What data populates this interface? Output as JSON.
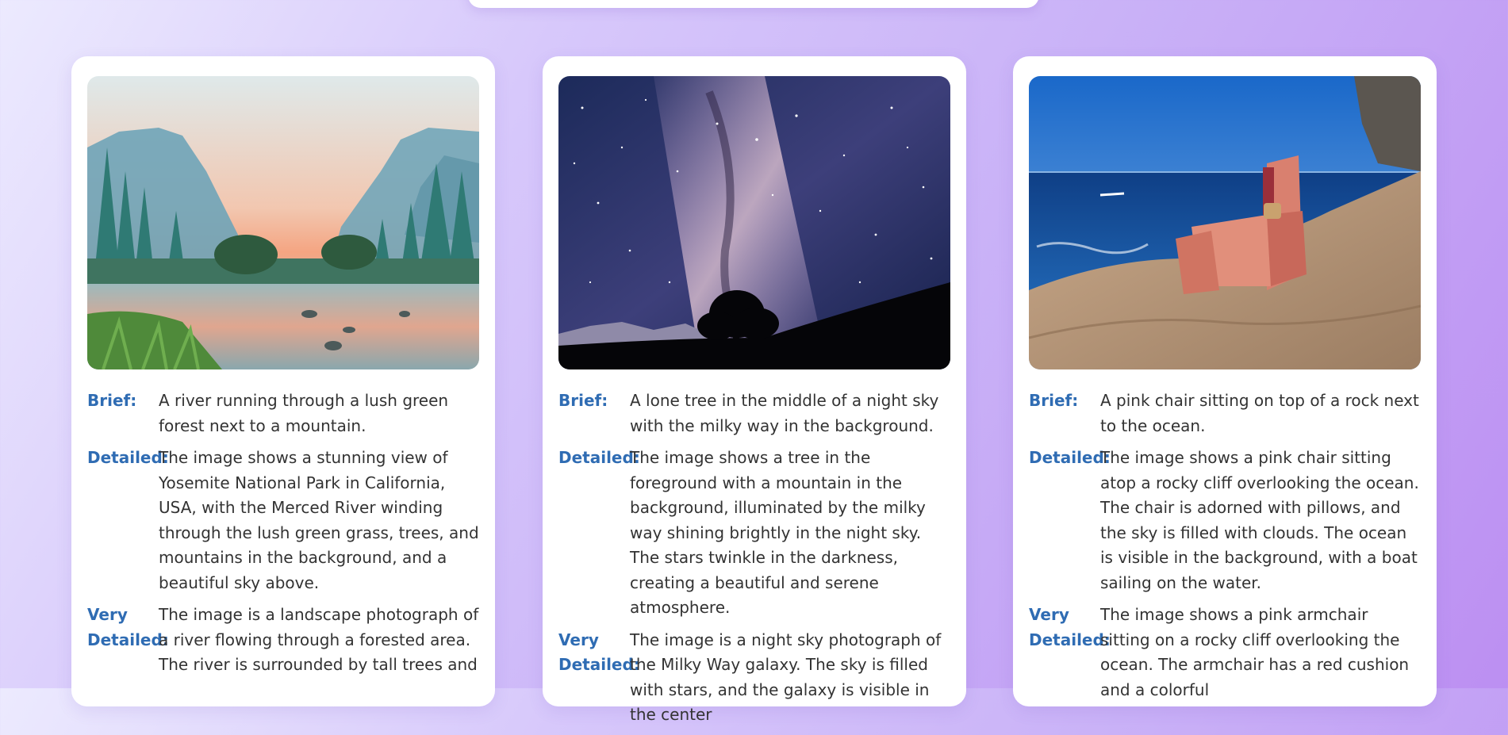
{
  "labels": {
    "brief": "Brief:",
    "detailed": "Detailed:",
    "very_word": "Very",
    "very_detailed_word": "Detailed:"
  },
  "cards": [
    {
      "image": "yosemite-river-landscape-photo",
      "brief": "A river running through a lush green forest next to a mountain.",
      "detailed": "The image shows a stunning view of Yosemite National Park in California, USA, with the Merced River winding through the lush green grass, trees, and mountains in the background, and a beautiful sky above.",
      "very_detailed": "The image is a landscape photograph of a river flowing through a forested area. The river is surrounded by tall trees and"
    },
    {
      "image": "milky-way-night-sky-photo",
      "brief": "A lone tree in the middle of a night sky with the milky way in the background.",
      "detailed": "The image shows a tree in the foreground with a mountain in the background, illuminated by the milky way shining brightly in the night sky. The stars twinkle in the darkness, creating a beautiful and serene atmosphere.",
      "very_detailed": "The image is a night sky photograph of the Milky Way galaxy. The sky is filled with stars, and the galaxy is visible in the center"
    },
    {
      "image": "pink-chair-ocean-cliff-photo",
      "brief": "A pink chair sitting on top of a rock next to the ocean.",
      "detailed": "The image shows a pink chair sitting atop a rocky cliff overlooking the ocean. The chair is adorned with pillows, and the sky is filled with clouds. The ocean is visible in the background, with a boat sailing on the water.",
      "very_detailed": "The image shows a pink armchair sitting on a rocky cliff overlooking the ocean. The armchair has a red cushion and a colorful"
    }
  ],
  "colors": {
    "label": "#2f6cb3",
    "text": "#333333",
    "card": "#ffffff"
  }
}
